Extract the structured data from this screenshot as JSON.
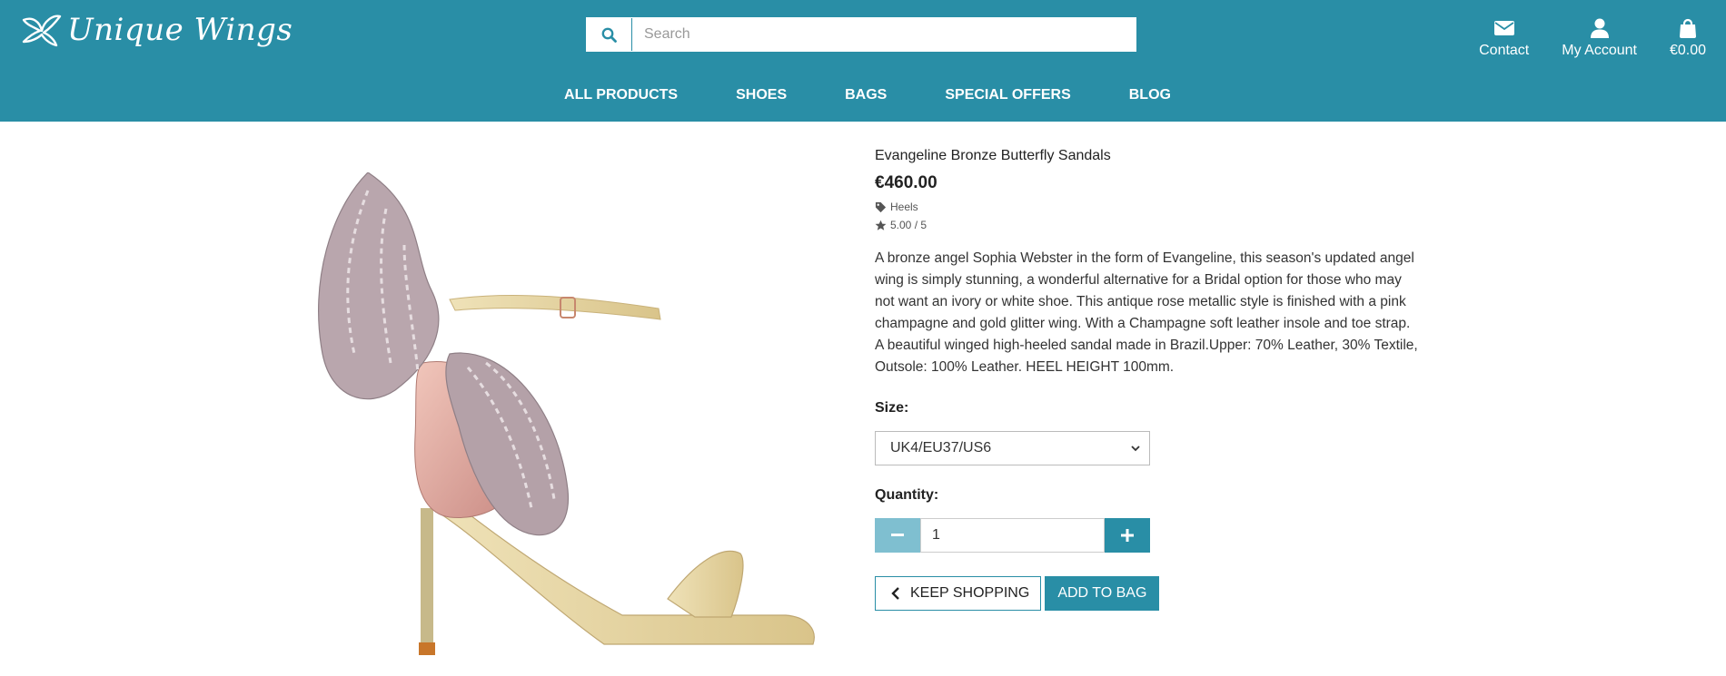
{
  "brand": {
    "name": "Unique Wings"
  },
  "search": {
    "placeholder": "Search"
  },
  "top_links": {
    "contact": {
      "label": "Contact",
      "icon": "envelope-icon"
    },
    "account": {
      "label": "My Account",
      "icon": "user-icon"
    },
    "bag": {
      "label": "€0.00",
      "icon": "shopping-bag-icon"
    }
  },
  "nav": {
    "items": [
      {
        "label": "ALL PRODUCTS"
      },
      {
        "label": "SHOES"
      },
      {
        "label": "BAGS"
      },
      {
        "label": "SPECIAL OFFERS"
      },
      {
        "label": "BLOG"
      }
    ]
  },
  "product": {
    "name": "Evangeline Bronze Butterfly Sandals",
    "price": "€460.00",
    "category": "Heels",
    "rating": "5.00 / 5",
    "description": "A bronze angel Sophia Webster in the form of Evangeline, this season's updated angel wing is simply stunning, a wonderful alternative for a Bridal option for those who may not want an ivory or white shoe. This antique rose metallic style is finished with a pink champagne and gold glitter wing. With a Champagne soft leather insole and toe strap. A beautiful winged high-heeled sandal made in Brazil.Upper: 70% Leather, 30% Textile, Outsole: 100% Leather. HEEL HEIGHT 100mm.",
    "size_label": "Size:",
    "size_selected": "UK4/EU37/US6",
    "quantity_label": "Quantity:",
    "quantity": "1"
  },
  "actions": {
    "keep_shopping": "KEEP SHOPPING",
    "add_to_bag": "ADD TO BAG"
  },
  "colors": {
    "primary": "#298ea6",
    "primary_light": "#7fbfd0"
  }
}
